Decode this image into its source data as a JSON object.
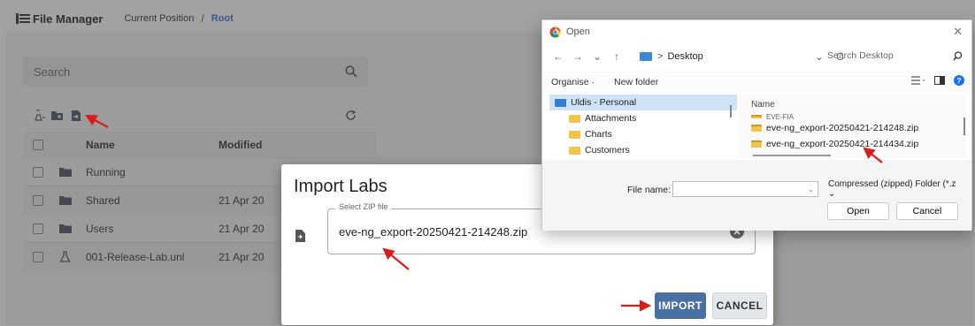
{
  "file_manager": {
    "app_title": "File Manager",
    "breadcrumb_label": "Current Position",
    "breadcrumb_separator": "/",
    "breadcrumb_root": "Root",
    "search_placeholder": "Search",
    "toolbar_icons": [
      "add-user-icon",
      "add-folder-icon",
      "import-file-icon",
      "refresh-icon"
    ],
    "table": {
      "col_name": "Name",
      "col_modified": "Modified",
      "rows": [
        {
          "icon": "folder-icon",
          "name": "Running",
          "modified": ""
        },
        {
          "icon": "folder-icon",
          "name": "Shared",
          "modified": "21 Apr 20"
        },
        {
          "icon": "folder-icon",
          "name": "Users",
          "modified": "21 Apr 20"
        },
        {
          "icon": "lab-flask-icon",
          "name": "001-Release-Lab.unl",
          "modified": "21 Apr 20"
        }
      ]
    }
  },
  "import_dialog": {
    "title": "Import Labs",
    "field_legend": "Select ZIP file",
    "field_value": "eve-ng_export-20250421-214248.zip",
    "import_label": "IMPORT",
    "cancel_label": "CANCEL"
  },
  "open_dialog": {
    "title": "Open",
    "close_glyph": "✕",
    "nav": {
      "back": "←",
      "forward": "→",
      "recent": "⌄",
      "up": "↑"
    },
    "address_prefix": ">",
    "address_location": "Desktop",
    "address_dropdown": "⌄",
    "address_refresh": "C",
    "search_placeholder": "Search Desktop",
    "organise_label": "Organise ·",
    "new_folder_label": "New folder",
    "nav_pane": [
      {
        "label": "Uldis - Personal",
        "selected": true
      },
      {
        "label": "Attachments",
        "selected": false
      },
      {
        "label": "Charts",
        "selected": false
      },
      {
        "label": "Customers",
        "selected": false
      }
    ],
    "files_header": "Name",
    "files": [
      {
        "name": "EVE-FIA",
        "partial": true
      },
      {
        "name": "eve-ng_export-20250421-214248.zip",
        "partial": false
      },
      {
        "name": "eve-ng_export-20250421-214434.zip",
        "partial": false
      }
    ],
    "file_name_label": "File name:",
    "file_name_value": "",
    "file_type": "Compressed (zipped) Folder (*.z ⌄",
    "open_label": "Open",
    "cancel_label": "Cancel"
  },
  "colors": {
    "import_button": "#4a6fa3",
    "breadcrumb_root": "#3a6fd1",
    "annotation_arrow": "#d91c1c",
    "nav_selected": "#cfe3f7"
  }
}
